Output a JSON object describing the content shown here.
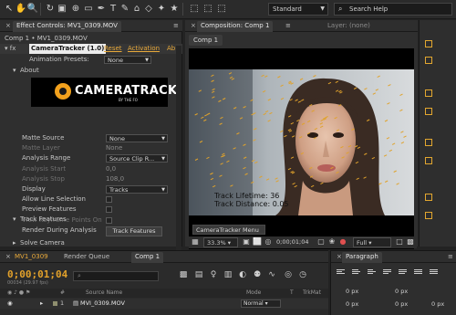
{
  "colors": {
    "accent": "#e8a93a",
    "panel_bg": "#2f2f2f",
    "tracker_marker": "#e0a22b"
  },
  "toolbar": {
    "workspace_value": "Standard",
    "search_label": "Search Help"
  },
  "effect_controls": {
    "tab_label": "Effect Controls: MV1_0309.MOV",
    "breadcrumb": "Comp 1 • MV1_0309.MOV",
    "effect_name": "CameraTracker (1.0)",
    "effect_reset": "Reset",
    "effect_activation": "Activation",
    "effect_about_short": "Ab",
    "animation_presets_label": "Animation Presets:",
    "animation_presets_value": "None",
    "about_label": "About",
    "logo_word": "CAMERATRACK",
    "logo_tagline": "BY THE FO",
    "rows": [
      {
        "label": "Matte Source",
        "type": "dropdown",
        "value": "None",
        "dim": false
      },
      {
        "label": "Matte Layer",
        "type": "text",
        "value": "None",
        "dim": true
      },
      {
        "label": "Analysis Range",
        "type": "dropdown",
        "value": "Source Clip R...",
        "dim": false
      },
      {
        "label": "Analysis Start",
        "type": "text",
        "value": "0,0",
        "dim": true
      },
      {
        "label": "Analysis Stop",
        "type": "text",
        "value": "108,0",
        "dim": true
      },
      {
        "label": "Display",
        "type": "dropdown",
        "value": "Tracks",
        "dim": false
      },
      {
        "label": "Allow Line Selection",
        "type": "checkbox",
        "value": "",
        "dim": false
      },
      {
        "label": "Preview Features",
        "type": "checkbox",
        "value": "",
        "dim": false
      },
      {
        "label": "View Keyframe Points On",
        "type": "checkbox",
        "value": "",
        "dim": true
      },
      {
        "label": "Render During Analysis",
        "type": "checkbox",
        "value": "✓",
        "dim": false
      }
    ],
    "track_features_label": "Track Features",
    "track_features_button": "Track Features",
    "solve_camera_label": "Solve Camera"
  },
  "composition": {
    "tab_label": "Composition: Comp 1",
    "layer_tab_label": "Layer: (none)",
    "breadcrumb": "Comp 1",
    "overlay_line1": "Track Lifetime: 36",
    "overlay_line2": "Track Distance: 0.05",
    "camera_menu": "CameraTracker Menu",
    "zoom": "33.3%",
    "timecode": "0;00;01;04",
    "resolution": "Full"
  },
  "timeline": {
    "tab1": "MV1_0309",
    "tab2": "Render Queue",
    "tab3": "Comp 1",
    "timecode": "0;00;01;04",
    "fps": "00034 (29.97 fps)",
    "col_source": "Source Name",
    "col_mode": "Mode",
    "col_t": "T",
    "col_trkmat": "TrkMat",
    "layer_number": "1",
    "layer_name": "MVI_0309.MOV",
    "layer_mode": "Normal"
  },
  "paragraph": {
    "tab_label": "Paragraph",
    "px_values": [
      "0 px",
      "0 px",
      "0 px",
      "0 px",
      "0 px"
    ]
  }
}
